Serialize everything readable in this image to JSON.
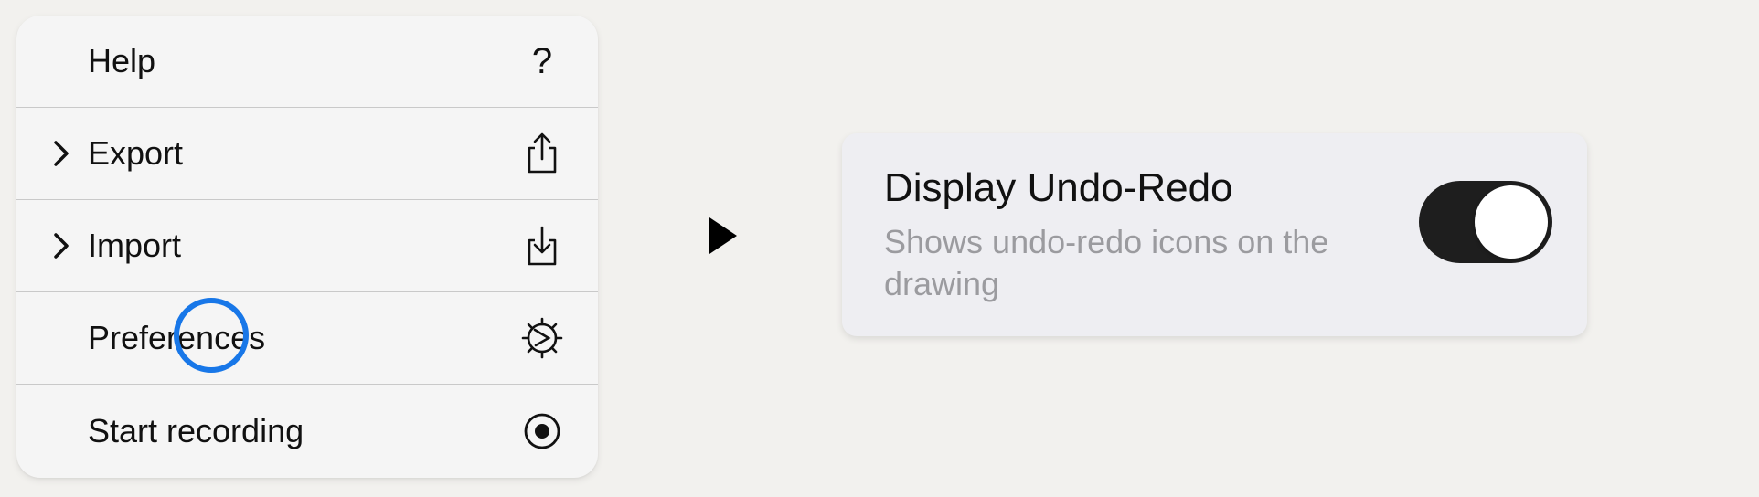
{
  "menu": {
    "items": [
      {
        "label": "Help",
        "icon": "question-mark-icon",
        "has_submenu": false
      },
      {
        "label": "Export",
        "icon": "share-export-icon",
        "has_submenu": true
      },
      {
        "label": "Import",
        "icon": "tray-import-icon",
        "has_submenu": true
      },
      {
        "label": "Preferences",
        "icon": "gear-icon",
        "has_submenu": false
      },
      {
        "label": "Start recording",
        "icon": "record-icon",
        "has_submenu": false
      }
    ],
    "help_glyph": "?"
  },
  "setting": {
    "title": "Display Undo-Redo",
    "description": "Shows undo-redo icons on the drawing",
    "toggle_on": true
  },
  "colors": {
    "cursor_ring": "#1877e8",
    "toggle_track_on": "#1e1e1e",
    "description_text": "#9b9b9f"
  }
}
